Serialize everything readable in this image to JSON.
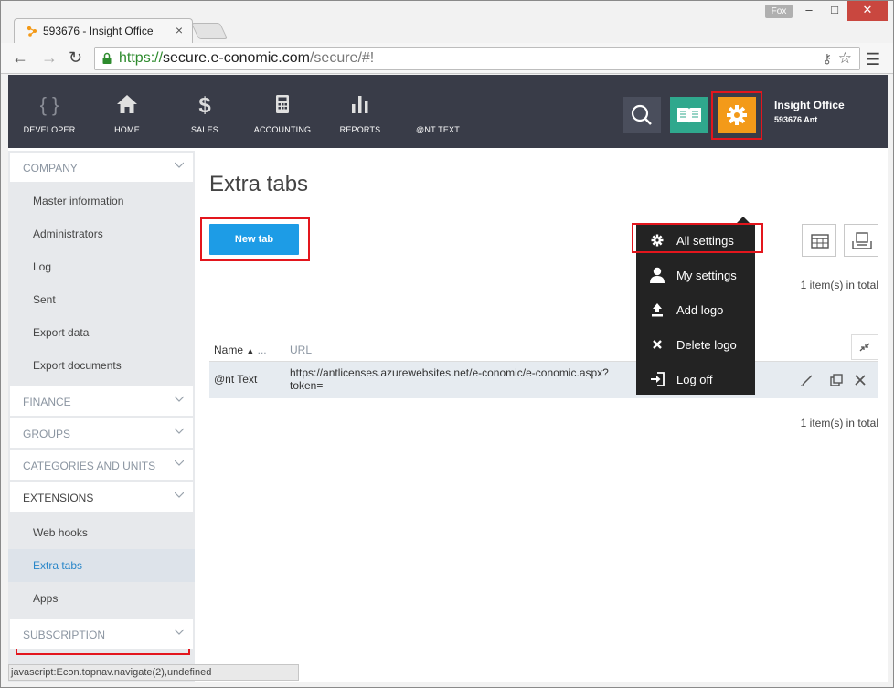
{
  "browser": {
    "tab_title": "593676 - Insight Office",
    "window_user": "Fox",
    "url_scheme": "https://",
    "url_host": "secure.e-conomic.com",
    "url_rest": "/secure/#!",
    "status_text": "javascript:Econ.topnav.navigate(2),undefined"
  },
  "topnav": {
    "items": [
      {
        "label": "DEVELOPER",
        "icon": "braces-icon"
      },
      {
        "label": "HOME",
        "icon": "home-icon"
      },
      {
        "label": "SALES",
        "icon": "dollar-icon"
      },
      {
        "label": "ACCOUNTING",
        "icon": "calculator-icon"
      },
      {
        "label": "REPORTS",
        "icon": "bar-chart-icon"
      },
      {
        "label": "@NT TEXT",
        "icon": ""
      }
    ],
    "user_name": "Insight Office",
    "company_id": "593676 Ant"
  },
  "sidebar": {
    "sections": [
      {
        "label": "COMPANY",
        "items": [
          "Master information",
          "Administrators",
          "Log",
          "Sent",
          "Export data",
          "Export documents"
        ]
      },
      {
        "label": "FINANCE"
      },
      {
        "label": "GROUPS"
      },
      {
        "label": "CATEGORIES AND UNITS"
      },
      {
        "label": "EXTENSIONS",
        "items": [
          "Web hooks",
          "Extra tabs",
          "Apps"
        ]
      },
      {
        "label": "SUBSCRIPTION"
      }
    ]
  },
  "main": {
    "title": "Extra tabs",
    "new_tab_label": "New tab",
    "count_text": "1 item(s) in total",
    "columns": {
      "name": "Name",
      "name_extra": "...",
      "url": "URL"
    },
    "rows": [
      {
        "name": "@nt Text",
        "url_line1": "https://antlicenses.azurewebsites.net/e-conomic/e-conomic.aspx?",
        "url_line2": "token="
      }
    ]
  },
  "dropdown": {
    "items": [
      "All settings",
      "My settings",
      "Add logo",
      "Delete logo",
      "Log off"
    ]
  },
  "colors": {
    "topnav_bg": "#393c48",
    "accent_blue": "#1d9ce6",
    "gear_orange": "#f39a19",
    "book_green": "#2fa88d",
    "highlight_red": "#e3161d"
  }
}
